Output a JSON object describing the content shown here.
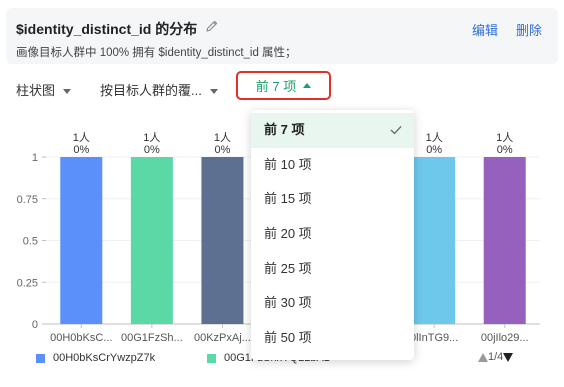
{
  "header": {
    "title": "$identity_distinct_id 的分布",
    "subtitle": "画像目标人群中 100% 拥有 $identity_distinct_id 属性；",
    "edit_label": "编辑",
    "delete_label": "删除"
  },
  "toolbar": {
    "chart_type": "柱状图",
    "metric": "按目标人群的覆...",
    "top_n": "前 7 项"
  },
  "dropdown": {
    "options": [
      "前 7 项",
      "前 10 项",
      "前 15 项",
      "前 20 项",
      "前 25 项",
      "前 30 项",
      "前 50 项"
    ],
    "selected": "前 7 项"
  },
  "chart_data": {
    "type": "bar",
    "categories": [
      "00H0bKsC...",
      "00G1FzSh...",
      "00KzPxAj...",
      "",
      "",
      "0lInTG9...",
      "00jIlo29..."
    ],
    "values": [
      1,
      1,
      1,
      1,
      1,
      1,
      1
    ],
    "top_labels": [
      "1人",
      "1人",
      "1人",
      "1人",
      "1人",
      "1人",
      "1人"
    ],
    "percent_labels": [
      "0%",
      "0%",
      "0%",
      "0%",
      "0%",
      "0%",
      "0%"
    ],
    "colors": [
      "#5b8ff9",
      "#5ad8a6",
      "#5d7092",
      "#f6bd16",
      "#e8684a",
      "#6dc8ec",
      "#9661bc"
    ],
    "yticks": [
      "0",
      "0.25",
      "0.5",
      "0.75",
      "1"
    ],
    "ylim": [
      0,
      1
    ]
  },
  "legend": {
    "items": [
      {
        "label": "00H0bKsCrYwzpZ7k",
        "color": "#5b8ff9"
      },
      {
        "label": "00G1FzShxYQLLbA1",
        "color": "#5ad8a6"
      }
    ],
    "pager": "1/4"
  }
}
